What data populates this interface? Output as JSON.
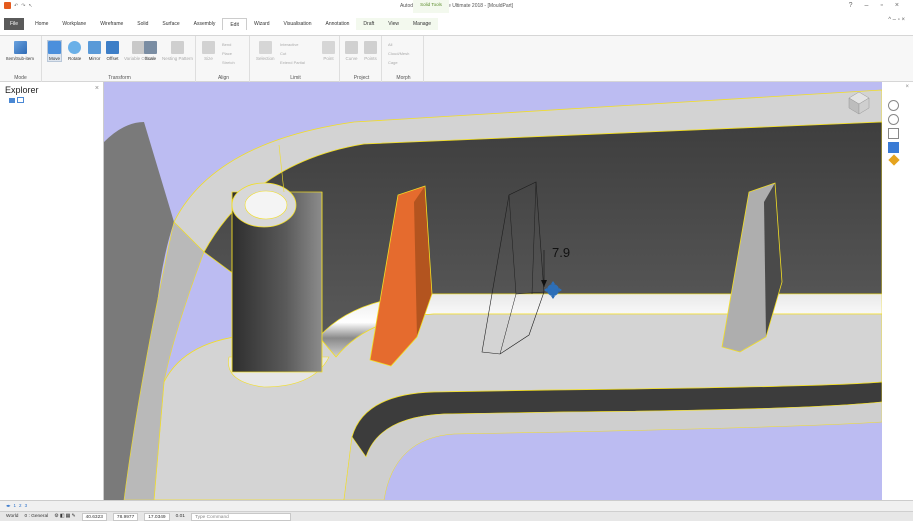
{
  "titlebar": {
    "title": "Autodesk PowerShape Ultimate 2018 - [MouldPart]",
    "context_tab_title": "Solid Tools",
    "qat_items": [
      "undo",
      "redo",
      "select"
    ],
    "window_controls": [
      "?",
      "–",
      "▫",
      "×"
    ]
  },
  "tabs": [
    "File",
    "Home",
    "Workplane",
    "Wireframe",
    "Solid",
    "Surface",
    "Assembly",
    "Edit",
    "Wizard",
    "Visualisation",
    "Annotation",
    "Draft",
    "View",
    "Manage"
  ],
  "active_tab": "Edit",
  "ribbon": {
    "groups": [
      {
        "label": "Mode",
        "buttons": [
          "Item/Sub-item"
        ]
      },
      {
        "label": "Transform",
        "buttons": [
          "Move",
          "Rotate",
          "Mirror",
          "Offset",
          "Variable Offset",
          "Scale",
          "Nesting Pattern"
        ]
      },
      {
        "label": "Align",
        "buttons": [
          "Size",
          "Bend",
          "Place",
          "Stretch"
        ]
      },
      {
        "label": "Limit",
        "buttons": [
          "Selection",
          "Interactive",
          "Cut",
          "Extend Partial",
          "Point"
        ]
      },
      {
        "label": "Project",
        "buttons": [
          "Curve",
          "Points"
        ]
      },
      {
        "label": "Morph",
        "buttons": [
          "All",
          "Cloud/Mesh",
          "Cage"
        ]
      }
    ]
  },
  "explorer": {
    "title": "Explorer",
    "close": "×"
  },
  "viewport": {
    "dimension_value": "7.9",
    "colors": {
      "background": "#bcbcf2",
      "dark_wall": "#4a4a4a",
      "face": "#cfcfcf",
      "orange_rib": "#e56b2e",
      "grey_rib": "#aeaeae",
      "edge": "#f2de25"
    }
  },
  "right_toolbar": {
    "close": "×"
  },
  "bottom": {
    "page_numbers": [
      "1",
      "2",
      "3"
    ]
  },
  "statusbar": {
    "workplane": "World",
    "level": "0 : General",
    "x": "40.6323",
    "y": "78.9977",
    "z": "17.0349",
    "tolerance": "0.01",
    "command_placeholder": "Type Command"
  }
}
